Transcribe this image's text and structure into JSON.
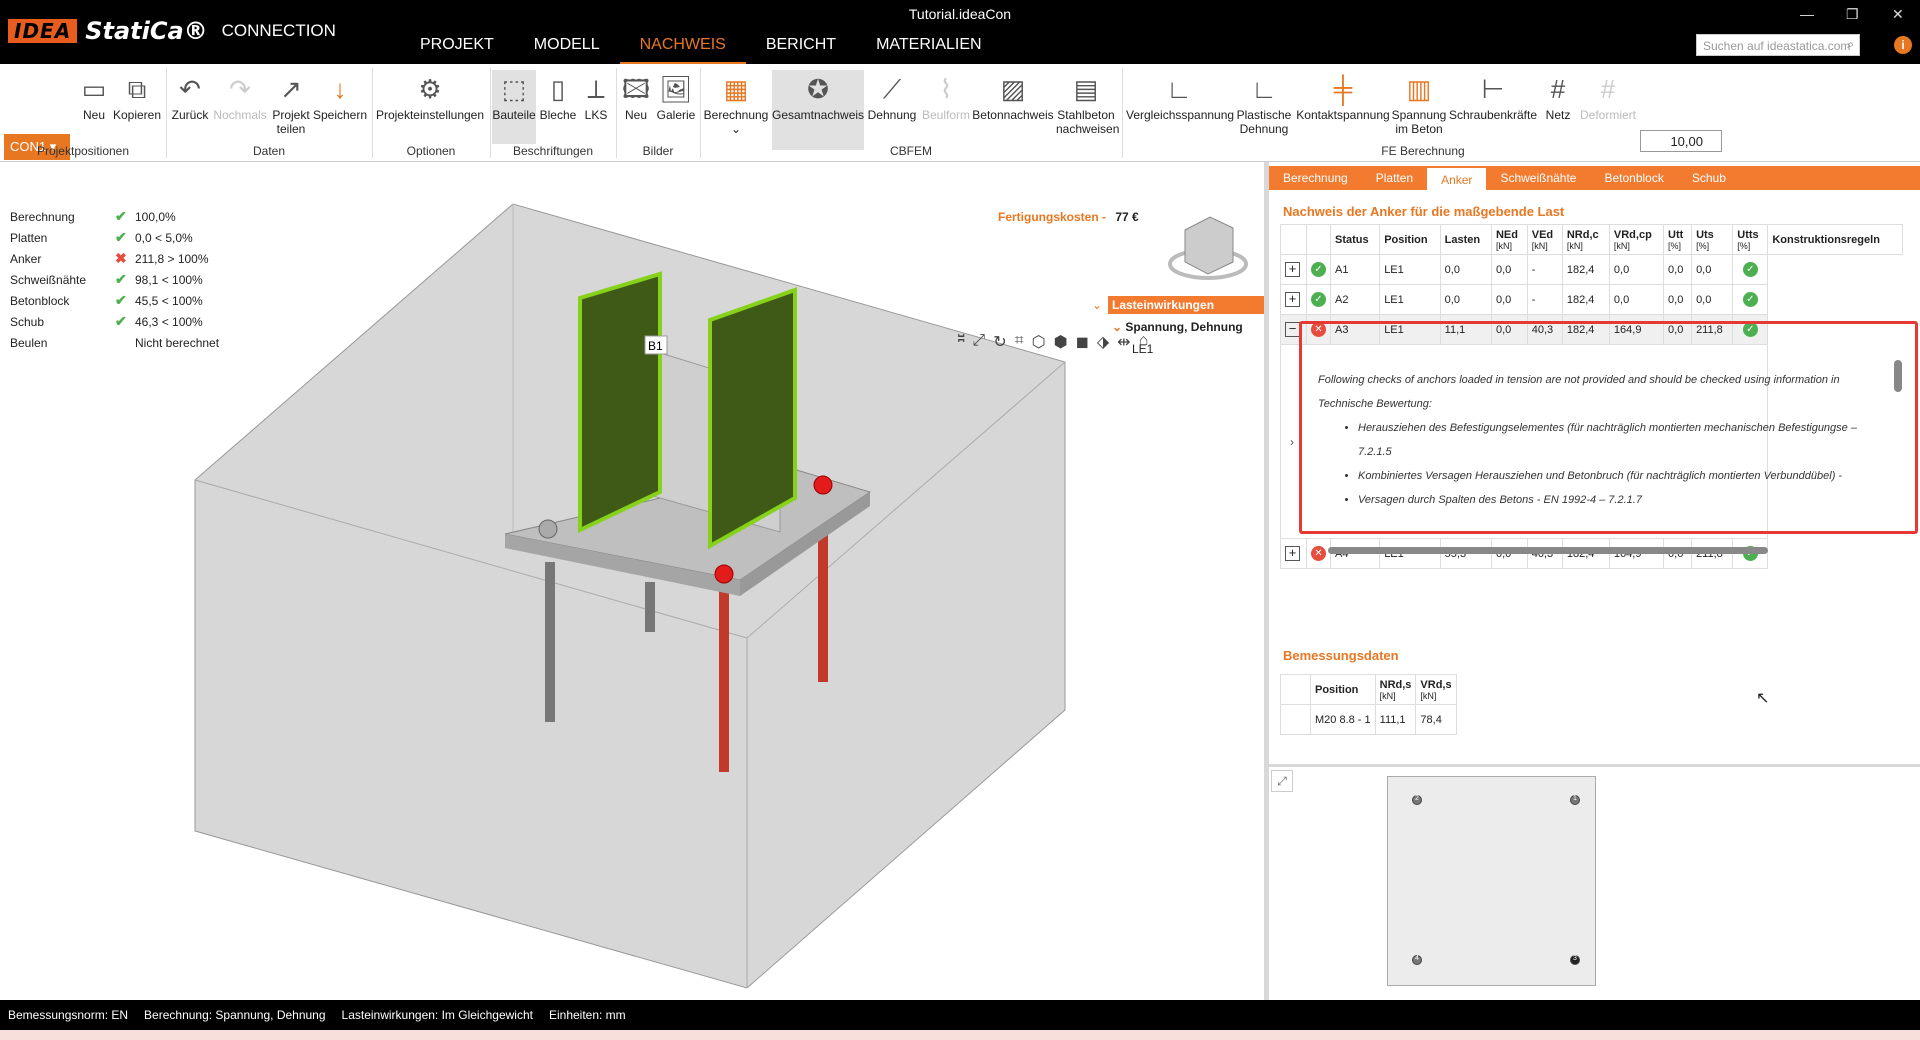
{
  "window": {
    "title": "Tutorial.ideaCon",
    "logo_idea": "IDEA",
    "logo_statica": "StatiCa®",
    "logo_product": "CONNECTION",
    "min": "—",
    "max": "❐",
    "close": "✕"
  },
  "menu": [
    "PROJEKT",
    "MODELL",
    "NACHWEIS",
    "BERICHT",
    "MATERIALIEN"
  ],
  "search": {
    "placeholder": "Suchen auf ideastatica.com"
  },
  "ribbon": {
    "con": "CON1",
    "buttons": [
      "Neu",
      "Kopieren",
      "Zurück",
      "Nochmals",
      "Projekt teilen",
      "Speichern",
      "Projekteinstellungen",
      "Bauteile",
      "Bleche",
      "LKS",
      "Neu",
      "Galerie",
      "Berechnung",
      "Gesamtnachweis",
      "Dehnung",
      "Beulform",
      "Betonnachweis",
      "Stahlbeton nachweisen",
      "Vergleichsspannung",
      "Plastische Dehnung",
      "Kontaktspannung",
      "Spannung im Beton",
      "Schraubenkräfte",
      "Netz",
      "Deformiert"
    ],
    "groups": [
      "Projektpositionen",
      "Daten",
      "Optionen",
      "Beschriftungen",
      "Bilder",
      "CBFEM",
      "FE Berechnung"
    ],
    "zoom": "10,00"
  },
  "results": [
    {
      "label": "Berechnung",
      "status": "ok",
      "value": "100,0%"
    },
    {
      "label": "Platten",
      "status": "ok",
      "value": "0,0 < 5,0%"
    },
    {
      "label": "Anker",
      "status": "bad",
      "value": "211,8 > 100%"
    },
    {
      "label": "Schweißnähte",
      "status": "ok",
      "value": "98,1 < 100%"
    },
    {
      "label": "Betonblock",
      "status": "ok",
      "value": "45,5 < 100%"
    },
    {
      "label": "Schub",
      "status": "ok",
      "value": "46,3 < 100%"
    },
    {
      "label": "Beulen",
      "status": "none",
      "value": "Nicht berechnet"
    }
  ],
  "cost": {
    "label": "Fertigungskosten",
    "value": "77 €"
  },
  "tree": {
    "root": "Lasteinwirkungen",
    "child": "Spannung, Dehnung",
    "leaf": "LE1"
  },
  "model_label": "B1",
  "tabs": [
    "Berechnung",
    "Platten",
    "Anker",
    "Schweißnähte",
    "Betonblock",
    "Schub"
  ],
  "anchor_section": "Nachweis der Anker für die maßgebende Last",
  "anchor_headers": [
    "",
    "Status",
    "Position",
    "Lasten",
    "NEd",
    "VEd",
    "NRd,c",
    "VRd,cp",
    "Utt",
    "Uts",
    "Utts",
    "Konstruktionsregeln"
  ],
  "anchor_units": [
    "",
    "",
    "",
    "",
    "[kN]",
    "[kN]",
    "[kN]",
    "[kN]",
    "[%]",
    "[%]",
    "[%]",
    ""
  ],
  "anchor_rows": [
    {
      "pm": "+",
      "status": "ok",
      "pos": "A1",
      "load": "LE1",
      "ned": "0,0",
      "ved": "0,0",
      "nrdc": "-",
      "vrdcp": "182,4",
      "utt": "0,0",
      "uts": "0,0",
      "utts": "0,0"
    },
    {
      "pm": "+",
      "status": "ok",
      "pos": "A2",
      "load": "LE1",
      "ned": "0,0",
      "ved": "0,0",
      "nrdc": "-",
      "vrdcp": "182,4",
      "utt": "0,0",
      "uts": "0,0",
      "utts": "0,0"
    },
    {
      "pm": "−",
      "status": "bad",
      "pos": "A3",
      "load": "LE1",
      "ned": "11,1",
      "ved": "0,0",
      "nrdc": "40,3",
      "vrdcp": "182,4",
      "utt": "164,9",
      "uts": "0,0",
      "utts": "211,8"
    },
    {
      "pm": "+",
      "status": "bad",
      "pos": "A4",
      "load": "LE1",
      "ned": "55,3",
      "ved": "0,0",
      "nrdc": "40,3",
      "vrdcp": "182,4",
      "utt": "164,9",
      "uts": "0,0",
      "utts": "211,8"
    }
  ],
  "detail": {
    "intro": "Following checks of anchors loaded in tension are not provided and should be checked using information in Technische Bewertung:",
    "items": [
      "Herausziehen des Befestigungselementes (für nachträglich montierten mechanischen Befestigungse – 7.2.1.5",
      "Kombiniertes Versagen Herausziehen und Betonbruch (für nachträglich montierten Verbunddübel) -",
      "Versagen durch Spalten des Betons - EN 1992-4 – 7.2.1.7"
    ]
  },
  "design_section": "Bemessungsdaten",
  "design_headers": [
    "Position",
    "NRd,s",
    "VRd,s"
  ],
  "design_units": [
    "",
    "[kN]",
    "[kN]"
  ],
  "design_row": [
    "M20 8.8 - 1",
    "111,1",
    "78,4"
  ],
  "preview_labels": [
    "2",
    "1",
    "4",
    "3"
  ],
  "statusbar": [
    "Bemessungsnorm: EN",
    "Berechnung: Spannung, Dehnung",
    "Lasteinwirkungen: Im Gleichgewicht",
    "Einheiten: mm"
  ]
}
